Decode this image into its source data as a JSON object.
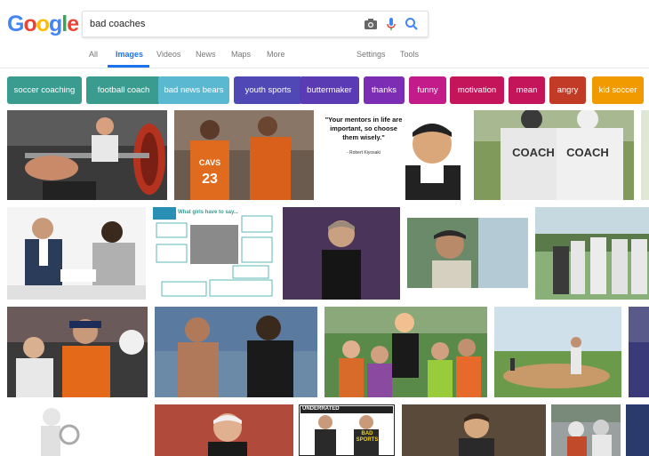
{
  "search": {
    "query": "bad coaches"
  },
  "logo": {
    "letters": [
      "G",
      "o",
      "o",
      "g",
      "l",
      "e"
    ],
    "colors": [
      "#4285f4",
      "#ea4335",
      "#fbbc05",
      "#4285f4",
      "#34a853",
      "#ea4335"
    ]
  },
  "nav": {
    "tabs": [
      {
        "label": "All"
      },
      {
        "label": "Images",
        "active": true
      },
      {
        "label": "Videos"
      },
      {
        "label": "News"
      },
      {
        "label": "Maps"
      },
      {
        "label": "More"
      }
    ],
    "settings": "Settings",
    "tools": "Tools"
  },
  "chips": [
    {
      "label": "soccer coaching",
      "color": "#3a9b8f"
    },
    {
      "label": "football coach",
      "color": "#3a9b8f"
    },
    {
      "label": "bad news bears",
      "color": "#5bb8d1"
    },
    {
      "label": "youth sports",
      "color": "#5048b4"
    },
    {
      "label": "buttermaker",
      "color": "#5b3bb3"
    },
    {
      "label": "thanks",
      "color": "#7b2db3"
    },
    {
      "label": "funny",
      "color": "#c41b8a"
    },
    {
      "label": "motivation",
      "color": "#c4155a"
    },
    {
      "label": "mean",
      "color": "#c4155a"
    },
    {
      "label": "angry",
      "color": "#c23b27"
    },
    {
      "label": "kid soccer",
      "color": "#f09a00"
    }
  ],
  "images": {
    "quote_text": "\"Your mentors in life are important, so choose them wisely.\"",
    "quote_author": "- Robert Kiyosaki",
    "jersey_23": "23",
    "jersey_word": "CAVS",
    "coach_label_1": "COACH",
    "coach_label_2": "COACH",
    "comic_title": "What girls have to say...",
    "bad_sports": "BAD SPORTS",
    "underrated": "UNDERRATED"
  },
  "colors": {
    "accent": "#1a73e8"
  }
}
